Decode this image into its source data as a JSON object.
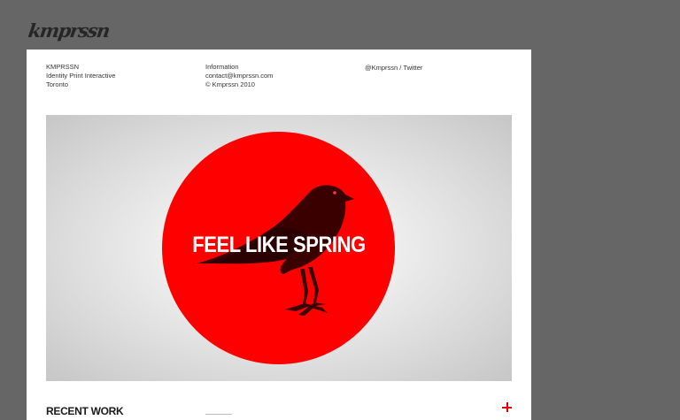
{
  "header": {
    "logo": "kmprssn"
  },
  "info": {
    "col1": [
      "KMPRSSN",
      "Identity Print Interactive",
      "Toronto"
    ],
    "col2": [
      "Information",
      "contact@kmprssn.com",
      "© Kmprssn 2010"
    ],
    "col3": "@Kmprssn / Twitter"
  },
  "hero": {
    "headline": "FEEL LIKE SPRING",
    "circle_color": "#ff0000"
  },
  "recent": {
    "title": "RECENT WORK",
    "expand_icon": "plus-icon",
    "accent": "#e60000"
  }
}
